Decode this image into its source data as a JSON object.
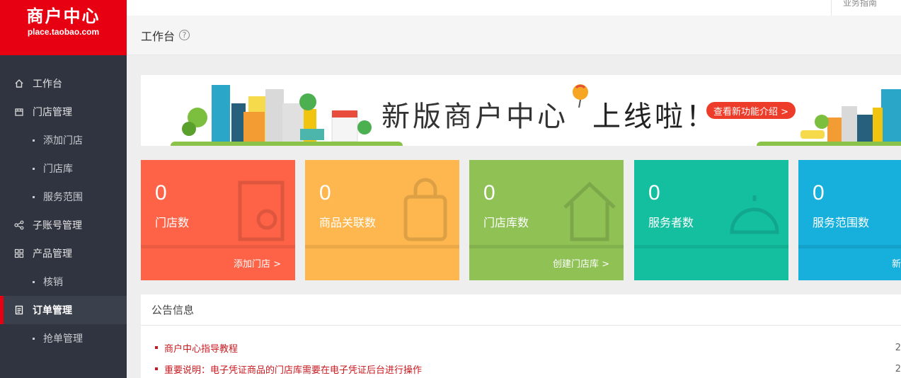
{
  "logo": {
    "title_cn": "商户中心",
    "title_en": "place.taobao.com"
  },
  "topbar": {
    "guide": "业务指南"
  },
  "page": {
    "title": "工作台",
    "help": "?"
  },
  "sidebar": {
    "items": [
      {
        "label": "工作台",
        "icon": "home-icon",
        "level": 1
      },
      {
        "label": "门店管理",
        "icon": "store-icon",
        "level": 1
      },
      {
        "label": "添加门店",
        "level": 2
      },
      {
        "label": "门店库",
        "level": 2
      },
      {
        "label": "服务范围",
        "level": 2
      },
      {
        "label": "子账号管理",
        "icon": "share-icon",
        "level": 1
      },
      {
        "label": "产品管理",
        "icon": "grid-icon",
        "level": 1
      },
      {
        "label": "核销",
        "level": 2
      },
      {
        "label": "订单管理",
        "icon": "order-icon",
        "level": 1,
        "active": true
      },
      {
        "label": "抢单管理",
        "level": 2
      }
    ]
  },
  "banner": {
    "headline": "新版商户中心",
    "headline2": "上线啦！",
    "button": "查看新功能介绍 >"
  },
  "cards": [
    {
      "value": "0",
      "label": "门店数",
      "link": "添加门店 >",
      "color": "#fe6347"
    },
    {
      "value": "0",
      "label": "商品关联数",
      "link": "",
      "color": "#feb74e"
    },
    {
      "value": "0",
      "label": "门店库数",
      "link": "创建门店库 >",
      "color": "#8fc155"
    },
    {
      "value": "0",
      "label": "服务者数",
      "link": "",
      "color": "#14bfa0"
    },
    {
      "value": "0",
      "label": "服务范围数",
      "link": "新",
      "color": "#17b0dc"
    }
  ],
  "notice": {
    "title": "公告信息",
    "items": [
      {
        "text": "商户中心指导教程",
        "date": "2"
      },
      {
        "text": "重要说明：电子凭证商品的门店库需要在电子凭证后台进行操作",
        "date": "2"
      }
    ]
  },
  "colors": {
    "brand": "#e60012",
    "sidebar": "#2f3440",
    "accent_button": "#ee3c2a"
  }
}
